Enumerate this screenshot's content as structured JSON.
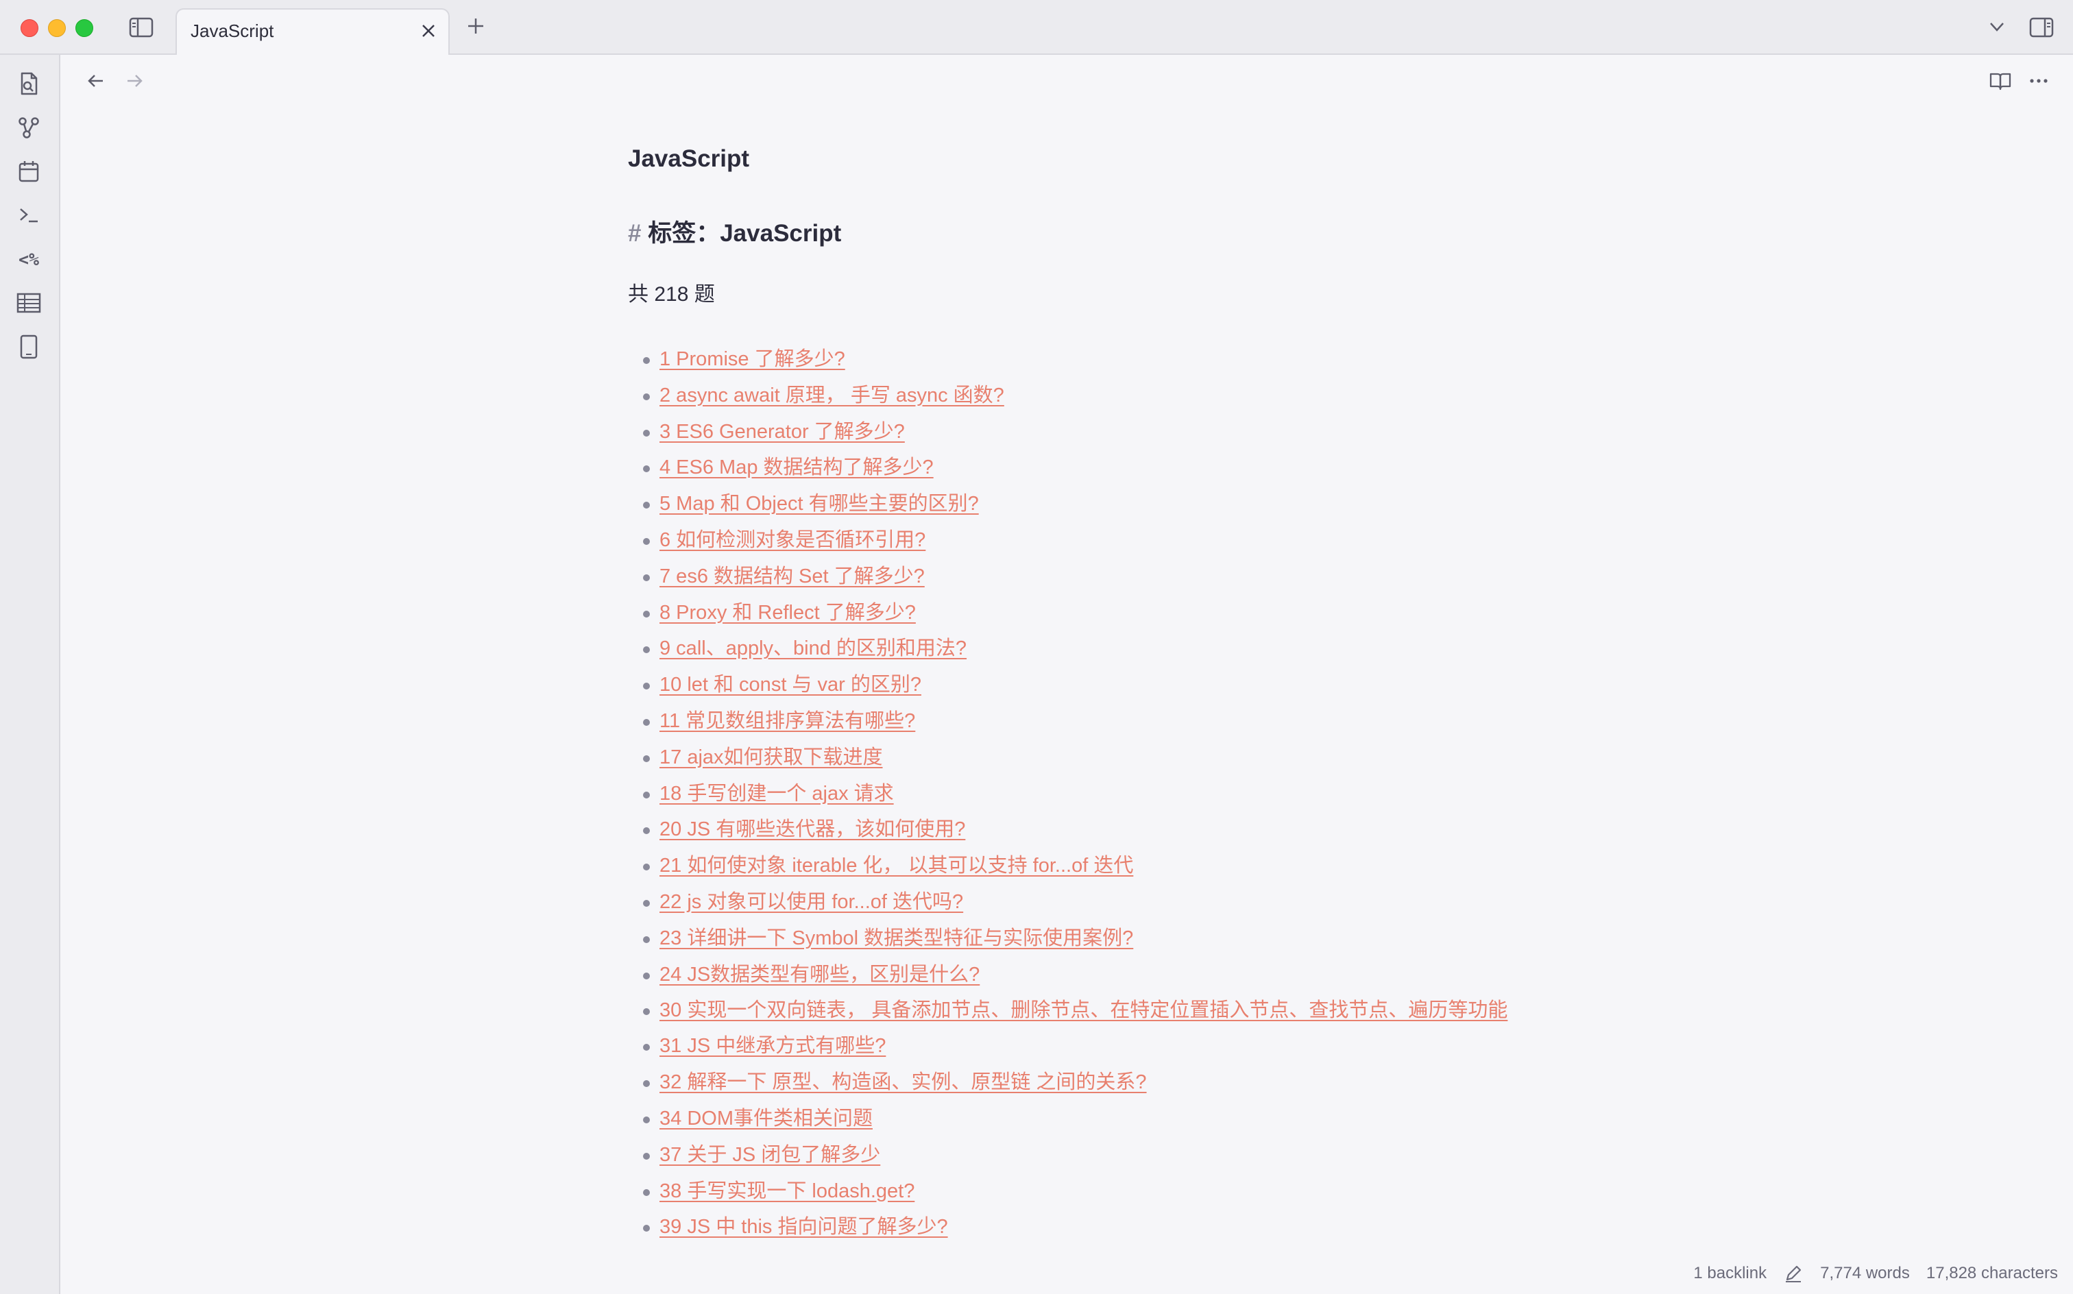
{
  "window": {
    "tab_title": "JavaScript"
  },
  "icons": {
    "sidebar_toggle": "sidebar-left-icon",
    "new_tab": "plus-icon",
    "tab_list": "chevron-down-icon",
    "right_sidebar": "sidebar-right-icon",
    "ribbon": [
      "file-search-icon",
      "graph-icon",
      "calendar-icon",
      "terminal-icon",
      "templater-icon",
      "table-icon",
      "tablet-icon"
    ],
    "back": "arrow-left-icon",
    "forward": "arrow-right-icon",
    "reading_view": "book-open-icon",
    "more": "more-options-icon"
  },
  "note": {
    "title": "JavaScript",
    "tag_hash": "#",
    "tag_heading": "标签：JavaScript",
    "count": "共 218 题",
    "questions": [
      "1 Promise 了解多少?",
      "2 async await 原理， 手写 async 函数?",
      "3 ES6 Generator 了解多少?",
      "4 ES6 Map 数据结构了解多少?",
      "5 Map 和 Object 有哪些主要的区别?",
      "6 如何检测对象是否循环引用?",
      "7 es6 数据结构 Set 了解多少?",
      "8 Proxy 和 Reflect 了解多少?",
      "9 call、apply、bind 的区别和用法?",
      "10 let 和 const 与 var 的区别?",
      "11 常见数组排序算法有哪些?",
      "17 ajax如何获取下载进度",
      "18 手写创建一个 ajax 请求",
      "20 JS 有哪些迭代器，该如何使用?",
      "21 如何使对象 iterable 化， 以其可以支持 for...of 迭代",
      "22 js 对象可以使用 for...of 迭代吗?",
      "23 详细讲一下 Symbol 数据类型特征与实际使用案例?",
      "24 JS数据类型有哪些，区别是什么?",
      "30 实现一个双向链表， 具备添加节点、删除节点、在特定位置插入节点、查找节点、遍历等功能",
      "31 JS 中继承方式有哪些?",
      "32 解释一下 原型、构造函、实例、原型链 之间的关系?",
      "34 DOM事件类相关问题",
      "37 关于 JS 闭包了解多少",
      "38 手写实现一下 lodash.get?",
      "39 JS 中 this 指向问题了解多少?"
    ]
  },
  "status": {
    "backlinks": "1 backlink",
    "words": "7,774 words",
    "characters": "17,828 characters"
  },
  "colors": {
    "link": "#e8806e",
    "background": "#f6f6f9",
    "chrome": "#ebebef"
  }
}
